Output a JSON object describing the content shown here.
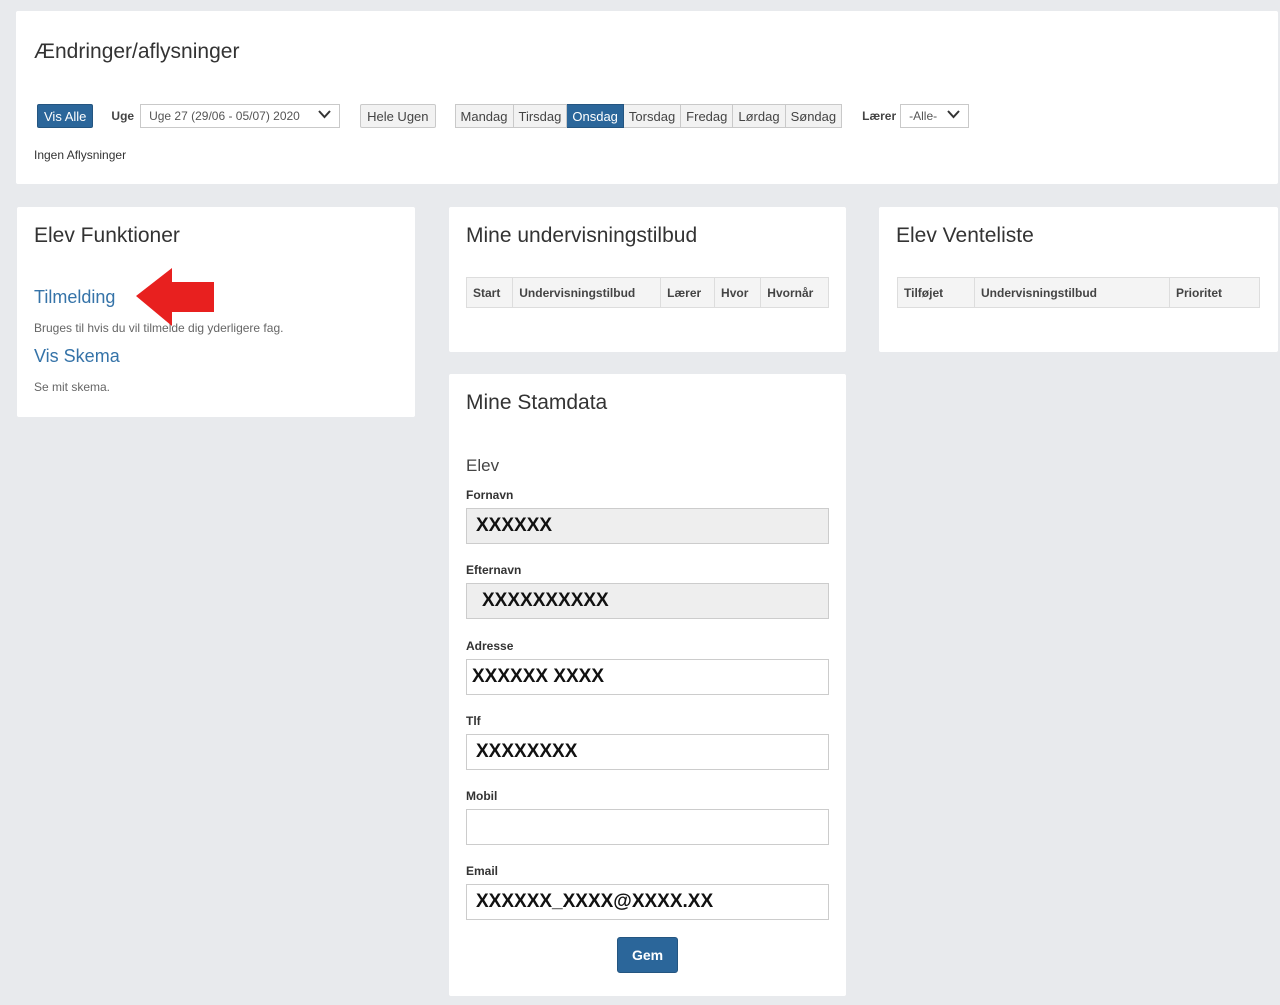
{
  "aendringer": {
    "title": "Ændringer/aflysninger",
    "vis_alle": "Vis Alle",
    "uge_label": "Uge",
    "uge_value": "Uge 27 (29/06 - 05/07) 2020",
    "hele_ugen": "Hele Ugen",
    "days": [
      "Mandag",
      "Tirsdag",
      "Onsdag",
      "Torsdag",
      "Fredag",
      "Lørdag",
      "Søndag"
    ],
    "active_day": "Onsdag",
    "laerer_label": "Lærer",
    "laerer_value": "-Alle-",
    "status": "Ingen Aflysninger"
  },
  "elev_funktioner": {
    "title": "Elev Funktioner",
    "tilmelding_link": "Tilmelding",
    "tilmelding_desc": "Bruges til hvis du vil tilmelde dig yderligere fag.",
    "skema_link": "Vis Skema",
    "skema_desc": "Se mit skema."
  },
  "undervisningstilbud": {
    "title": "Mine undervisningstilbud",
    "columns": [
      "Start",
      "Undervisningstilbud",
      "Lærer",
      "Hvor",
      "Hvornår"
    ]
  },
  "venteliste": {
    "title": "Elev Venteliste",
    "columns": [
      "Tilføjet",
      "Undervisningstilbud",
      "Prioritet"
    ]
  },
  "stamdata": {
    "title": "Mine Stamdata",
    "section": "Elev",
    "fields": [
      {
        "label": "Fornavn",
        "value": "XXXXXX"
      },
      {
        "label": "Efternavn",
        "value": "XXXXXXXXXX"
      },
      {
        "label": "Adresse",
        "value": "XXXXXX XXXX"
      },
      {
        "label": "Tlf",
        "value": "XXXXXXXX"
      },
      {
        "label": "Mobil",
        "value": ""
      },
      {
        "label": "Email",
        "value": "XXXXXX_XXXX@XXXX.XX"
      }
    ],
    "save_label": "Gem"
  },
  "colors": {
    "primary": "#2b669a",
    "link": "#3573a8",
    "arrow": "#e8201f",
    "background": "#e8eaed"
  }
}
